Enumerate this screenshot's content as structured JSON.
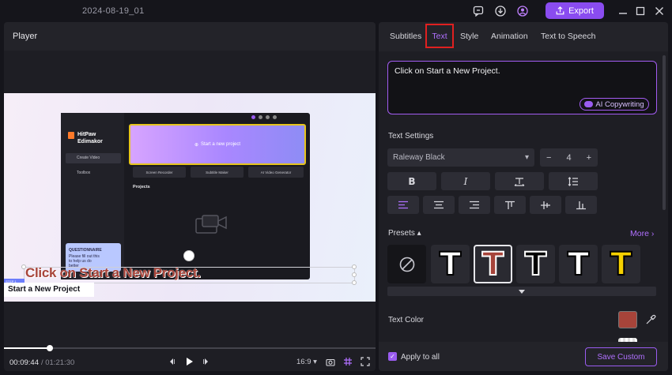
{
  "window": {
    "title": "2024-08-19_01",
    "export_label": "Export"
  },
  "player": {
    "title": "Player",
    "time_current": "00:09:44",
    "time_total": "/ 01:21:30",
    "progress": 0.124,
    "aspect_ratio": "16:9",
    "preview": {
      "app_name_line1": "HitPaw",
      "app_name_line2": "Edimakor",
      "side_create": "Create Video",
      "side_toolbox": "Toolbox",
      "start_label": "Start a new project",
      "tool_screen": "Screen Recorder",
      "tool_subtitle": "Subtitle Maker",
      "tool_ai": "AI Video Generator",
      "projects": "Projects",
      "questionnaire_title": "QUESTIONNAIRE",
      "questionnaire_body": "Please fill out this to help us do better",
      "caption": "Click on Start a New Project.",
      "step_tag": "STEP 1",
      "step_text": "Start a New Project"
    }
  },
  "panel": {
    "tabs": [
      "Subtitles",
      "Text",
      "Style",
      "Animation",
      "Text to Speech"
    ],
    "active_tab": "Text",
    "text_value": "Click on Start a New Project.",
    "ai_label": "AI Copywriting",
    "text_settings_label": "Text Settings",
    "font": "Raleway Black",
    "font_size": "4",
    "format_buttons": [
      "B",
      "I"
    ],
    "presets_label": "Presets",
    "more_label": "More",
    "presets": [
      {
        "glyph": "",
        "fill": "none"
      },
      {
        "glyph": "T",
        "fill": "#ffffff",
        "outline": "#000000"
      },
      {
        "glyph": "T",
        "fill": "#a7443a",
        "outline": "#ffffff"
      },
      {
        "glyph": "T",
        "fill": "#000000",
        "outline": "#ffffff"
      },
      {
        "glyph": "T",
        "fill": "#ffffff",
        "outline": "#000000"
      },
      {
        "glyph": "T",
        "fill": "#f5d000",
        "outline": "#000000"
      }
    ],
    "text_color_label": "Text Color",
    "text_color": "#a7443a",
    "apply_all_label": "Apply to all",
    "save_label": "Save Custom"
  },
  "colors": {
    "accent": "#9a5cf0",
    "export": "#8a4cf0",
    "highlight": "#e02020"
  }
}
